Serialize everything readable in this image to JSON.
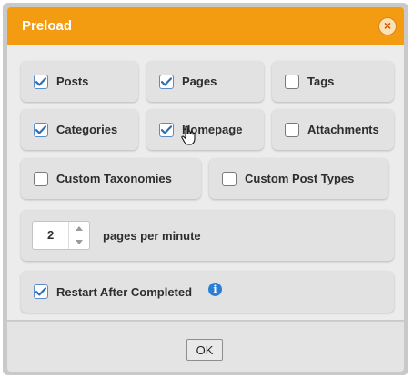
{
  "dialog": {
    "title": "Preload"
  },
  "options": [
    {
      "label": "Posts",
      "checked": true
    },
    {
      "label": "Pages",
      "checked": true
    },
    {
      "label": "Tags",
      "checked": false
    },
    {
      "label": "Categories",
      "checked": true
    },
    {
      "label": "Homepage",
      "checked": true
    },
    {
      "label": "Attachments",
      "checked": false
    },
    {
      "label": "Custom Taxonomies",
      "checked": false
    },
    {
      "label": "Custom Post Types",
      "checked": false
    }
  ],
  "rate": {
    "value": "2",
    "label": "pages per minute"
  },
  "restart": {
    "label": "Restart After Completed",
    "checked": true,
    "info_icon": "info-icon"
  },
  "footer": {
    "ok_label": "OK"
  },
  "colors": {
    "titlebar": "#f39c12",
    "checkbox_check": "#2f6fb5",
    "info": "#2a7fd4"
  }
}
